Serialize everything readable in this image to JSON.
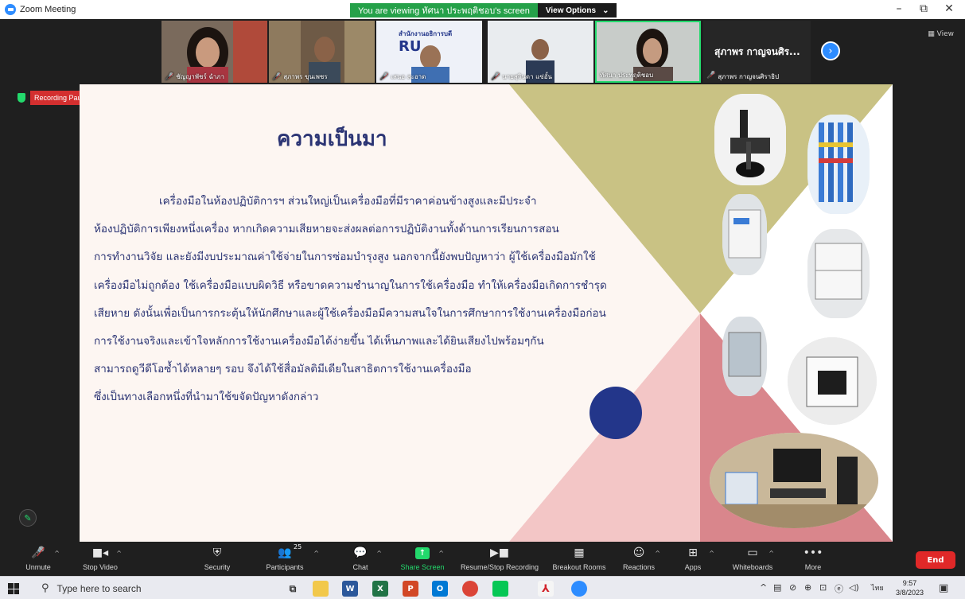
{
  "window": {
    "title": "Zoom Meeting",
    "viewing_text": "You are viewing ทัศนา ประพฤติชอบ's screen",
    "view_options": "View Options",
    "minimize": "–",
    "restore": "⧉",
    "close": "✕"
  },
  "participants_strip": {
    "thumbs": [
      {
        "name": "ชัญญาพัชร์ ฉำภา",
        "muted": true
      },
      {
        "name": "สุภาพร ขุนเพชร",
        "muted": true
      },
      {
        "name": "เสนอ สะอาด",
        "muted": true
      },
      {
        "name": "นายสุจินดา แซ่อั้น",
        "muted": true
      },
      {
        "name": "ทัศนา ประพฤติชอบ",
        "muted": false
      }
    ],
    "thumb_logo_text": "สำนักงานอธิการบดี",
    "thumb_logo_abbrev": "RU",
    "active_speaker": {
      "display": "สุภาพร กาญจนศิร...",
      "name": "สุภาพร กาญจนศิราธิป"
    },
    "view_label": "View"
  },
  "recording": {
    "status": "Recording Paused"
  },
  "slide": {
    "title": "ความเป็นมา",
    "lines": [
      "เครื่องมือในห้องปฏิบัติการฯ ส่วนใหญ่เป็นเครื่องมือที่มีราคาค่อนข้างสูงและมีประจำ",
      "ห้องปฏิบัติการเพียงหนึ่งเครื่อง หากเกิดความเสียหายจะส่งผลต่อการปฏิบัติงานทั้งด้านการเรียนการสอน",
      "การทำงานวิจัย และยังมีงบประมาณค่าใช้จ่ายในการซ่อมบำรุงสูง นอกจากนี้ยังพบปัญหาว่า ผู้ใช้เครื่องมือมักใช้",
      "เครื่องมือไม่ถูกต้อง ใช้เครื่องมือแบบผิดวิธี หรือขาดความชำนาญในการใช้เครื่องมือ ทำให้เครื่องมือเกิดการชำรุด",
      "เสียหาย ดังนั้นเพื่อเป็นการกระตุ้นให้นักศึกษาและผู้ใช้เครื่องมือมีความสนใจในการศึกษาการใช้งานเครื่องมือก่อน",
      "การใช้งานจริงและเข้าใจหลักการใช้งานเครื่องมือได้ง่ายขึ้น ได้เห็นภาพและได้ยินเสียงไปพร้อมๆกัน",
      "สามารถดูวีดีโอซ้ำได้หลายๆ รอบ จึงได้ใช้สื่อมัลติมีเดียในสาธิตการใช้งานเครื่องมือ",
      "ซึ่งเป็นทางเลือกหนึ่งที่นำมาใช้ขจัดปัญหาดังกล่าว"
    ],
    "colors": {
      "title": "#2b3474",
      "olive": "#c9c284",
      "pink": "#f3c6c6",
      "rose": "#d9868c",
      "dot": "#23368a"
    }
  },
  "toolbar": {
    "unmute": "Unmute",
    "stop_video": "Stop Video",
    "security": "Security",
    "participants": "Participants",
    "participants_count": "25",
    "chat": "Chat",
    "share_screen": "Share Screen",
    "recording": "Resume/Stop Recording",
    "breakout": "Breakout Rooms",
    "reactions": "Reactions",
    "apps": "Apps",
    "whiteboards": "Whiteboards",
    "more": "More",
    "end": "End"
  },
  "taskbar": {
    "search_placeholder": "Type here to search",
    "lang": "ไทย",
    "time": "9:57",
    "date": "3/8/2023",
    "apps": [
      "task-view",
      "file-explorer",
      "word",
      "excel",
      "powerpoint",
      "outlook",
      "chrome",
      "line",
      "acrobat",
      "zoom"
    ]
  }
}
